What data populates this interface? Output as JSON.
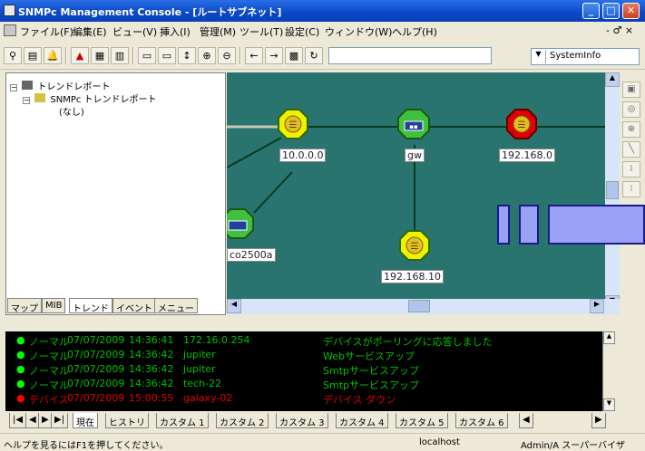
{
  "window": {
    "title": "SNMPc Management Console - [ルートサブネット]",
    "minimize": "_",
    "maximize": "□",
    "close": "✕",
    "mdi_controls": "- ♂ ×"
  },
  "menubar": {
    "items": [
      "ファイル(F)",
      "編集(E)",
      "ビュー(V)",
      "挿入(I)",
      "管理(M)",
      "ツール(T)",
      "設定(C)",
      "ウィンドウ(W)",
      "ヘルプ(H)"
    ]
  },
  "toolbar": {
    "buttons": [
      "binoculars-icon",
      "map-icon",
      "bell-icon",
      "alarm-icon",
      "chart-icon",
      "graph-icon",
      "window-icon",
      "window2-icon",
      "expand-icon",
      "zoom-in-icon",
      "zoom-out-icon",
      "back-icon",
      "forward-icon",
      "grid-icon",
      "refresh-icon"
    ],
    "select_value": "SystemInfo"
  },
  "tree": {
    "root": "トレンドレポート",
    "child": "SNMPc トレンドレポート",
    "leaf": "(なし)"
  },
  "left_tabs": [
    "マップ",
    "MIB",
    "トレンド",
    "イベント",
    "メニュー"
  ],
  "map": {
    "nodes": [
      {
        "label": "10.0.0.0",
        "color": "#f0f000",
        "type": "network",
        "status": "normal"
      },
      {
        "label": "gw",
        "color": "#40c040",
        "type": "router",
        "status": "normal"
      },
      {
        "label": "192.168.0",
        "color": "#e00000",
        "type": "network",
        "status": "critical"
      },
      {
        "label": "co2500a",
        "color": "#40c040",
        "type": "router",
        "status": "normal"
      },
      {
        "label": "192.168.10",
        "color": "#f0f000",
        "type": "network",
        "status": "normal"
      }
    ],
    "background": "#2a7470"
  },
  "events": {
    "rows": [
      {
        "status": "ノーマル",
        "date": "07/07/2009",
        "time": "14:36:41",
        "device": "172.16.0.254",
        "message": "デバイスがポーリングに応答しました",
        "color": "#00ff00"
      },
      {
        "status": "ノーマル",
        "date": "07/07/2009",
        "time": "14:36:42",
        "device": "jupiter",
        "message": "Webサービスアップ",
        "color": "#00ff00"
      },
      {
        "status": "ノーマル",
        "date": "07/07/2009",
        "time": "14:36:42",
        "device": "jupiter",
        "message": "Smtpサービスアップ",
        "color": "#00ff00"
      },
      {
        "status": "ノーマル",
        "date": "07/07/2009",
        "time": "14:36:42",
        "device": "tech-22",
        "message": "Smtpサービスアップ",
        "color": "#00ff00"
      },
      {
        "status": "デバイス",
        "date": "07/07/2009",
        "time": "15:00:55",
        "device": "galaxy-02",
        "message": "デバイス ダウン",
        "color": "#ff0000"
      }
    ]
  },
  "bottom_tabs": [
    "現在",
    "ヒストリ",
    "カスタム 1",
    "カスタム 2",
    "カスタム 3",
    "カスタム 4",
    "カスタム 5",
    "カスタム 6"
  ],
  "statusbar": {
    "help": "ヘルプを見るにはF1を押してください。",
    "server": "localhost",
    "user": "Admin/A スーパーバイザ"
  }
}
